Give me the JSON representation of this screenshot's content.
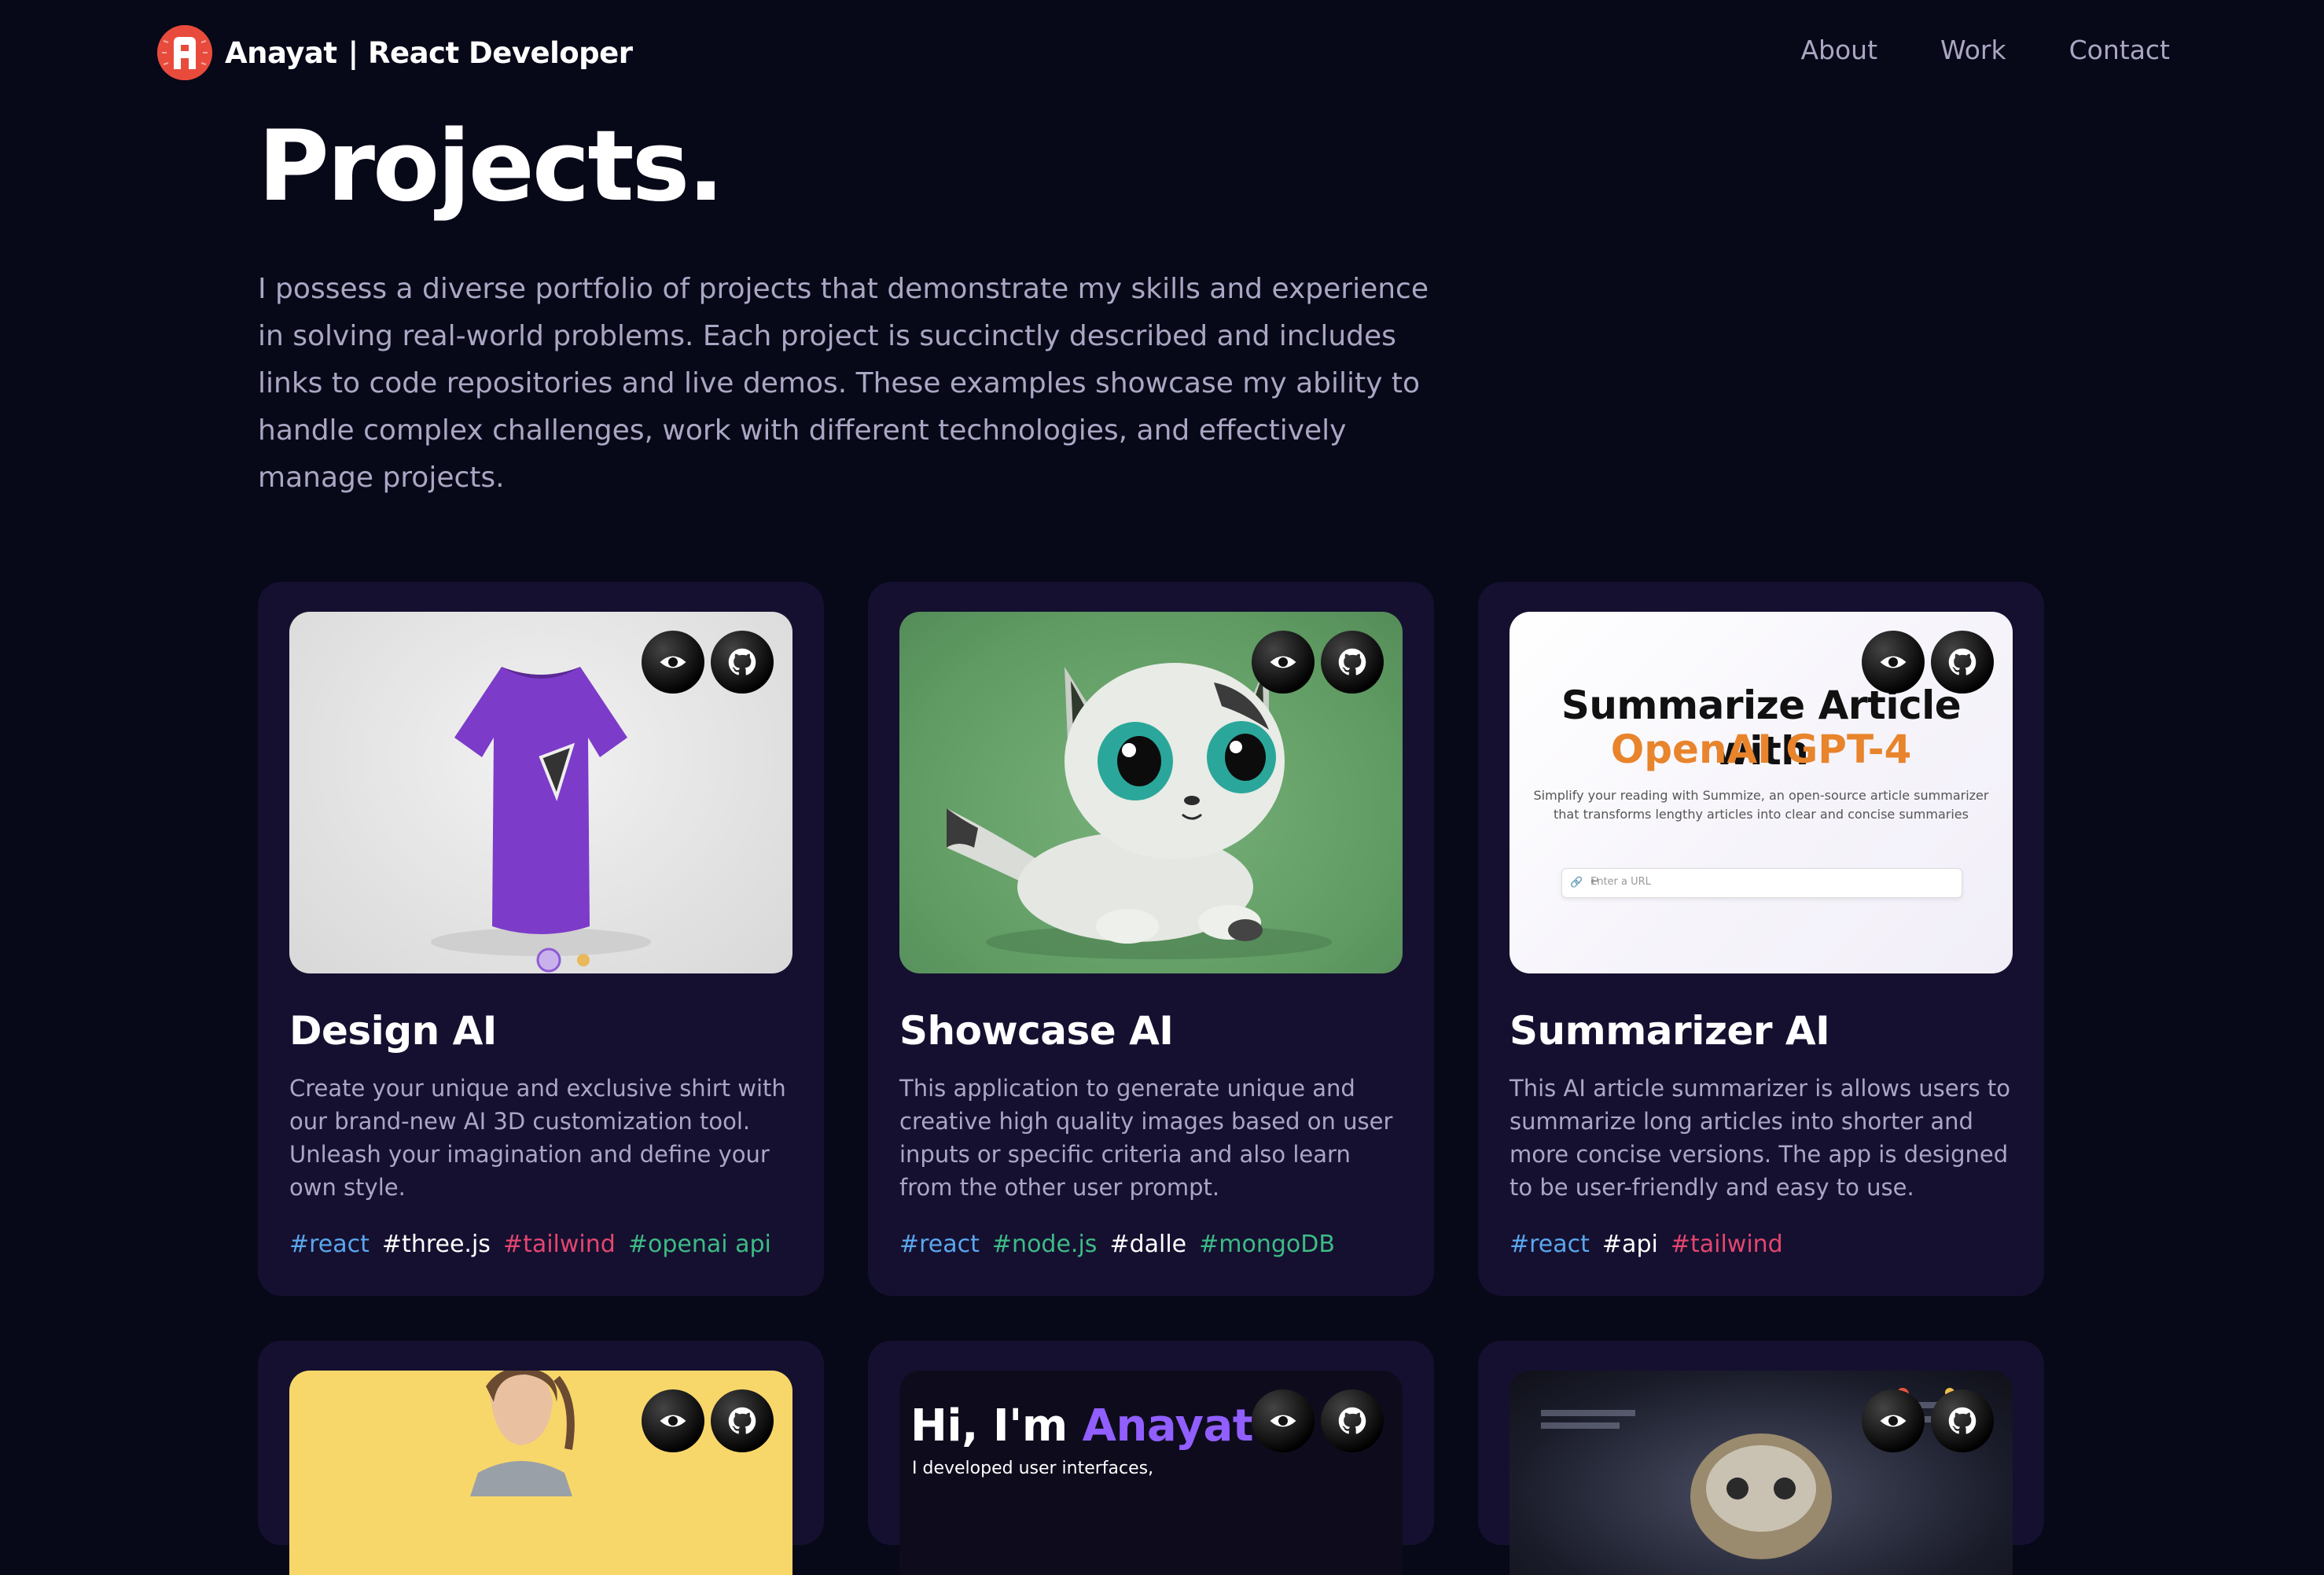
{
  "nav": {
    "brand_name": "Anayat",
    "brand_role": "| React Developer",
    "links": [
      "About",
      "Work",
      "Contact"
    ]
  },
  "hero": {
    "title": "Projects.",
    "description": "I possess a diverse portfolio of projects that demonstrate my skills and experience in solving real-world problems. Each project is succinctly described and includes links to code repositories and live demos. These examples showcase my ability to handle complex challenges, work with different technologies, and effectively manage projects."
  },
  "projects": [
    {
      "title": "Design AI",
      "description": "Create your unique and exclusive shirt with our brand-new AI 3D customization tool. Unleash your imagination and define your own style.",
      "tags": [
        {
          "label": "#react",
          "color": "#5aa7ee"
        },
        {
          "label": "#three.js",
          "color": "#ffffff"
        },
        {
          "label": "#tailwind",
          "color": "#e4466e"
        },
        {
          "label": "#openai api",
          "color": "#3dbb85"
        }
      ]
    },
    {
      "title": "Showcase AI",
      "description": "This application to generate unique and creative high quality images based on user inputs or specific criteria and also learn from the other user prompt.",
      "tags": [
        {
          "label": "#react",
          "color": "#5aa7ee"
        },
        {
          "label": "#node.js",
          "color": "#3dbb85"
        },
        {
          "label": "#dalle",
          "color": "#ffffff"
        },
        {
          "label": "#mongoDB",
          "color": "#3dbb85"
        }
      ]
    },
    {
      "title": "Summarizer AI",
      "description": "This AI article summarizer is allows users to summarize long articles into shorter and more concise versions. The app is designed to be user-friendly and easy to use.",
      "tags": [
        {
          "label": "#react",
          "color": "#5aa7ee"
        },
        {
          "label": "#api",
          "color": "#ffffff"
        },
        {
          "label": "#tailwind",
          "color": "#e4466e"
        }
      ],
      "thumb": {
        "heading_line1": "Summarize Article with",
        "heading_line2": "OpenAI GPT-4",
        "subtitle": "Simplify your reading with Summize, an open-source article summarizer that transforms lengthy articles into clear and concise summaries",
        "input_placeholder": "Enter a URL",
        "submit_glyph": "↵"
      }
    }
  ],
  "row2": {
    "portfolio_thumb": {
      "greeting": "Hi, I'm",
      "name": "Anayat",
      "line": "I developed user interfaces,"
    }
  },
  "icons": {
    "view": "eye-icon",
    "source": "github-icon"
  },
  "colors": {
    "background": "#070818",
    "card": "#151030",
    "secondary_text": "#aaa6c3",
    "logo": "#e84b3c",
    "accent": "#915eff"
  }
}
